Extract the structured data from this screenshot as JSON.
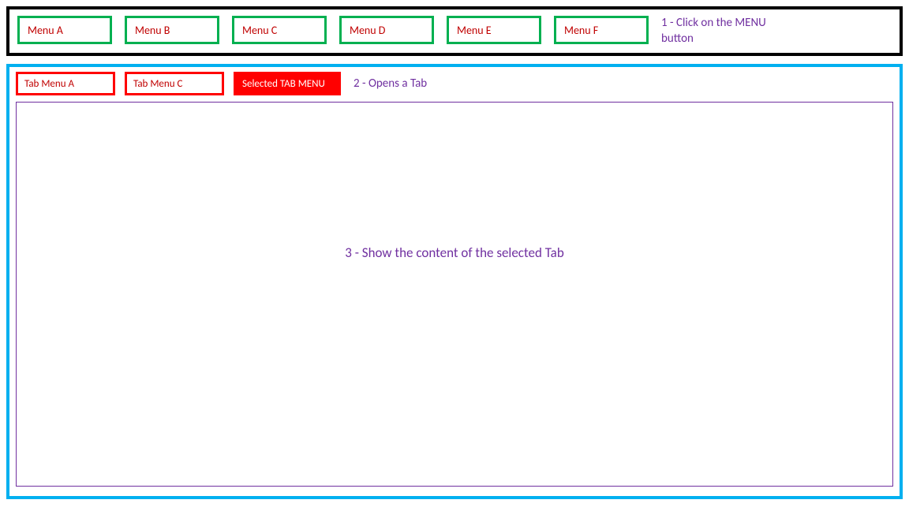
{
  "menu_bar": {
    "items": [
      {
        "label": "Menu A"
      },
      {
        "label": "Menu B"
      },
      {
        "label": "Menu C"
      },
      {
        "label": "Menu D"
      },
      {
        "label": "Menu E"
      },
      {
        "label": "Menu F"
      }
    ],
    "annotation": "1 - Click on the MENU button"
  },
  "tab_area": {
    "tabs": [
      {
        "label": "Tab Menu A",
        "selected": false
      },
      {
        "label": "Tab Menu C",
        "selected": false
      },
      {
        "label": "Selected TAB MENU",
        "selected": true
      }
    ],
    "annotation": "2 - Opens a Tab"
  },
  "content": {
    "annotation": "3 - Show the content of the selected Tab"
  },
  "colors": {
    "menu_border": "#00b050",
    "menu_text": "#c00000",
    "menubar_border": "#000000",
    "tab_container_border": "#00b0f0",
    "tab_border": "#ff0000",
    "tab_selected_bg": "#ff0000",
    "annotation_text": "#7030a0",
    "content_border": "#7030a0"
  }
}
